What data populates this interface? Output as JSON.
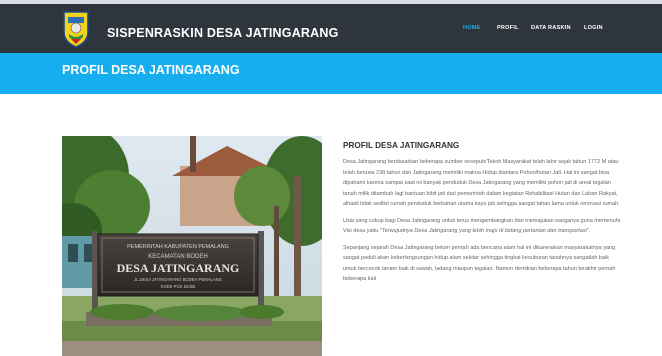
{
  "header": {
    "site_title": "SISPENRASKIN DESA JATINGARANG",
    "nav": [
      {
        "label": "HOME",
        "active": true
      },
      {
        "label": "PROFIL",
        "active": false
      },
      {
        "label": "DATA RASKIN",
        "active": false
      },
      {
        "label": "LOGIN",
        "active": false
      }
    ]
  },
  "banner": {
    "title": "PROFIL DESA JATINGARANG"
  },
  "photo": {
    "sign_line1": "PEMERINTAH KABUPATEN PEMALANG",
    "sign_line2": "KECAMATAN BODEH",
    "sign_line3": "DESA JATINGARANG",
    "sign_line4": "JL.DESA JATINGARANG BODEH PEMALANG",
    "sign_line5": "KODE POS 52365"
  },
  "article": {
    "heading": "PROFIL DESA JATINGARANG",
    "p1": "Desa Jatingarang berdasarkan beberapa sumber sesepuh/Tokoh Masyarakat telah lahir sejak tahun 1772 M atau telah berusia 238 tahun dan Jatingarang memiliki makna Hidup diantara Pohon/hutan Jati. Hal ini sangat bisa dipahami karena sampai saat ini banyak penduduk Desa Jatingarang yang memiliki pohon jati di areal tegalan tanah milik ditambah lagi bantuan bibit jati dari pemerintah dalam kegiatan Rehabilitasi Hutan dan Lahan Rakyat, alhasil tidak sedikit rumah penduduk berbahan utama kayu jati selingga sangat tahan lama untuk renovasi rumah.",
    "p2_text": "Usia yang cukup bagi Desa Jatingarang untuk terus mengembangkan dan memajukan warganya guna memenuhi Visi desa yaitu ",
    "p2_quote": "\"Terwujudnya Desa Jatingarang yang lebih maju di bidang pertanian dan transportasi\".",
    "p3": "Sepanjang sejarah Desa Jatingarang belum pernah ada bencana alam hal ini dikarenakan masyarakatnya yang sangat peduli akan keberlangsungan hidup alam sekitar sehingga tingkat kesuburan tanahnya sangatlah baik untuk bercocok tanam baik di sawah, ladang maupun tegalan. Namun demikian beberapa tahun terakhir pernah beberapa kali"
  },
  "colors": {
    "navbar": "#2e353c",
    "banner": "#16aeee",
    "nav_active": "#22a9e6"
  }
}
